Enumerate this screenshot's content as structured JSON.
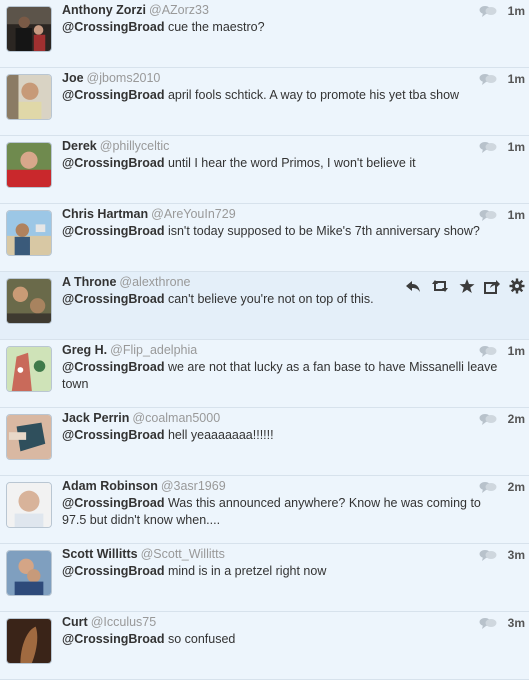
{
  "tweets": [
    {
      "name": "Anthony Zorzi",
      "handle": "@AZorz33",
      "mention": "@CrossingBroad",
      "text": " cue the maestro?",
      "time": "1m",
      "avatar": "avatar-anthony"
    },
    {
      "name": "Joe",
      "handle": "@jboms2010",
      "mention": "@CrossingBroad",
      "text": " april fools schtick. A way to promote his yet tba show",
      "time": "1m",
      "avatar": "avatar-joe"
    },
    {
      "name": "Derek",
      "handle": "@phillyceltic",
      "mention": "@CrossingBroad",
      "text": " until I hear the word Primos, I won't believe it",
      "time": "1m",
      "avatar": "avatar-derek"
    },
    {
      "name": "Chris Hartman",
      "handle": "@AreYouIn729",
      "mention": "@CrossingBroad",
      "text": " isn't today supposed to be Mike's 7th anniversary show?",
      "time": "1m",
      "avatar": "avatar-chris"
    },
    {
      "name": "A Throne",
      "handle": "@alexthrone",
      "mention": "@CrossingBroad",
      "text": " can't believe you're not on top of this.",
      "time": "",
      "avatar": "avatar-athrone",
      "hovered": true
    },
    {
      "name": "Greg H.",
      "handle": "@Flip_adelphia",
      "mention": "@CrossingBroad",
      "text": " we are not that lucky as a fan base to have Missanelli leave town",
      "time": "1m",
      "avatar": "avatar-greg"
    },
    {
      "name": "Jack Perrin",
      "handle": "@coalman5000",
      "mention": "@CrossingBroad",
      "text": " hell yeaaaaaaa!!!!!!",
      "time": "2m",
      "avatar": "avatar-jack"
    },
    {
      "name": "Adam Robinson",
      "handle": "@3asr1969",
      "mention": "@CrossingBroad",
      "text": " Was this announced anywhere? Know he was coming to 97.5 but didn't know when....",
      "time": "2m",
      "avatar": "avatar-adam"
    },
    {
      "name": "Scott Willitts",
      "handle": "@Scott_Willitts",
      "mention": "@CrossingBroad",
      "text": " mind is in a pretzel right now",
      "time": "3m",
      "avatar": "avatar-scott"
    },
    {
      "name": "Curt",
      "handle": "@Icculus75",
      "mention": "@CrossingBroad",
      "text": " so confused",
      "time": "3m",
      "avatar": "avatar-curt"
    }
  ],
  "colors": {
    "background": "#eef5fb",
    "divider": "#d7e2ec",
    "name": "#333333",
    "handle": "#999999"
  },
  "icons": {
    "conversation": "conversation-bubble-icon",
    "reply": "reply-icon",
    "retweet": "retweet-icon",
    "favorite": "star-icon",
    "share": "share-icon",
    "settings": "gear-icon"
  }
}
